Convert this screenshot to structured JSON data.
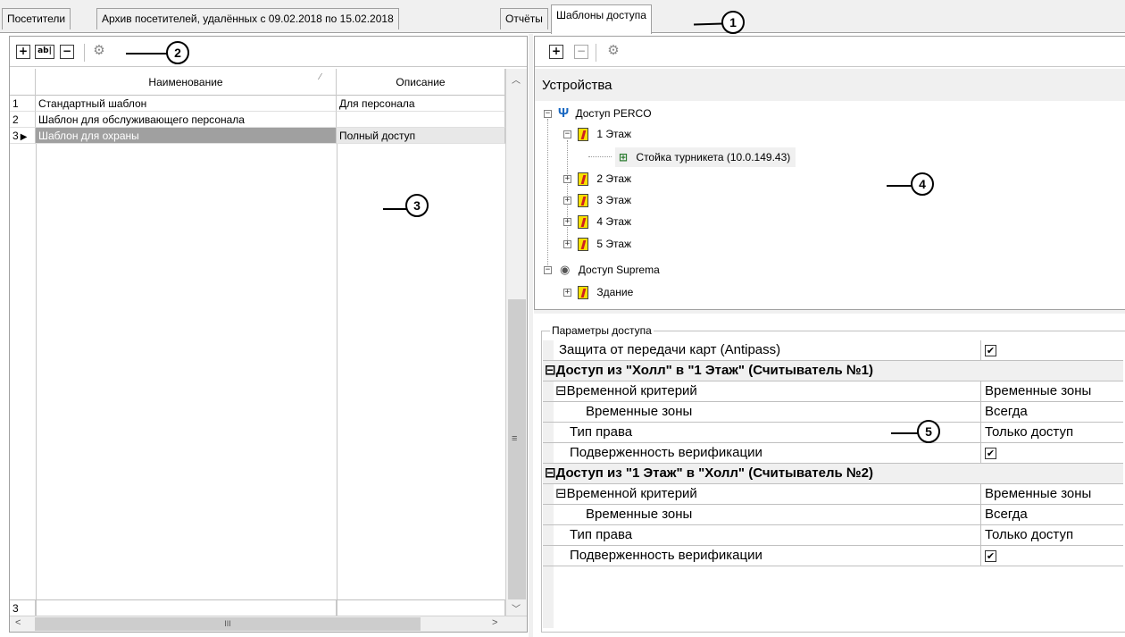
{
  "tabs": [
    {
      "label": "Посетители"
    },
    {
      "label": "Архив посетителей, удалённых с 09.02.2018 по 15.02.2018"
    },
    {
      "label": "Отчёты"
    },
    {
      "label": "Шаблоны доступа"
    }
  ],
  "callouts": [
    "1",
    "2",
    "3",
    "4",
    "5"
  ],
  "left_toolbar": {
    "buttons": [
      "+",
      "ab|",
      "−",
      "⚙"
    ]
  },
  "grid": {
    "headers": {
      "name": "Наименование",
      "desc": "Описание",
      "sort_mark": "⁄"
    },
    "rows": [
      {
        "num": "1",
        "name": "Стандартный шаблон",
        "desc": "Для персонала"
      },
      {
        "num": "2",
        "name": "Шаблон для обслуживающего персонала",
        "desc": ""
      },
      {
        "num": "3",
        "name": "Шаблон для охраны",
        "desc": "Полный доступ"
      }
    ],
    "footer_num": "3",
    "hscroll_thumb": "III"
  },
  "right_toolbar": {
    "buttons": [
      "+",
      "−",
      "⚙"
    ]
  },
  "tree": {
    "title": "Устройства",
    "nodes": [
      {
        "label": "Доступ PERCO"
      },
      {
        "label": "1 Этаж"
      },
      {
        "label": "Стойка турникета (10.0.149.43)"
      },
      {
        "label": "2 Этаж"
      },
      {
        "label": "3 Этаж"
      },
      {
        "label": "4 Этаж"
      },
      {
        "label": "5 Этаж"
      },
      {
        "label": "Доступ Suprema"
      },
      {
        "label": "Здание"
      }
    ]
  },
  "params": {
    "group_title": "Параметры доступа",
    "rows": [
      {
        "name": "Защита от передачи карт (Antipass)",
        "value": "✔"
      },
      {
        "name": "⊟Доступ из \"Холл\" в \"1 Этаж\" (Считыватель №1)",
        "value": ""
      },
      {
        "name": "⊟Временной критерий",
        "value": "Временные зоны"
      },
      {
        "name": "Временные зоны",
        "value": "Всегда"
      },
      {
        "name": "Тип права",
        "value": "Только доступ"
      },
      {
        "name": "Подверженность верификации",
        "value": "✔"
      },
      {
        "name": "⊟Доступ из \"1 Этаж\" в \"Холл\" (Считыватель №2)",
        "value": ""
      },
      {
        "name": "⊟Временной критерий",
        "value": "Временные зоны"
      },
      {
        "name": "Временные зоны",
        "value": "Всегда"
      },
      {
        "name": "Тип права",
        "value": "Только доступ"
      },
      {
        "name": "Подверженность верификации",
        "value": "✔"
      }
    ]
  }
}
